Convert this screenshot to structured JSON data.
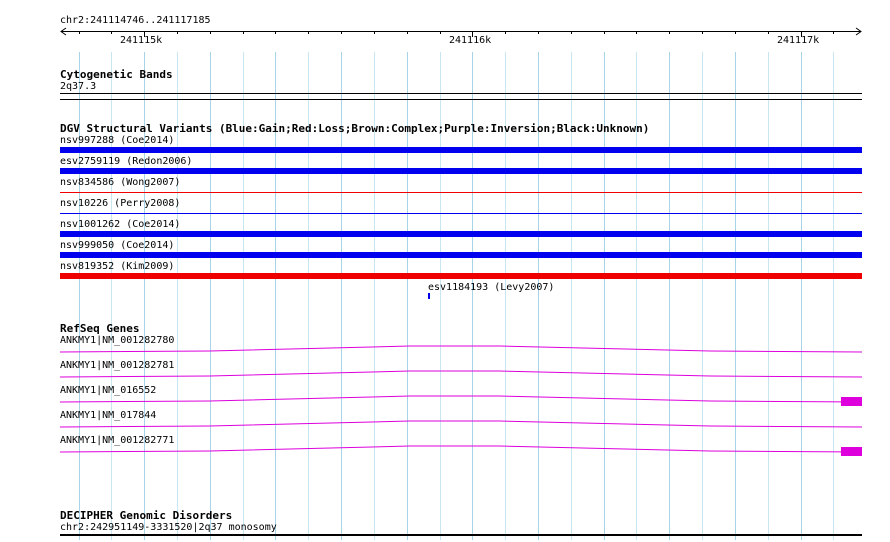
{
  "ruler": {
    "location": "chr2:241114746..241117185",
    "ticks": [
      "241115k",
      "241116k",
      "241117k"
    ]
  },
  "cytoband": {
    "title": "Cytogenetic Bands",
    "band": "2q37.3"
  },
  "dgv": {
    "title": "DGV Structural Variants (Blue:Gain;Red:Loss;Brown:Complex;Purple:Inversion;Black:Unknown)",
    "colors": {
      "gain": "#0000ee",
      "loss": "#ee0000"
    },
    "variants": [
      {
        "label": "nsv997288 (Coe2014)",
        "type": "gain",
        "weight": "thick"
      },
      {
        "label": "esv2759119 (Redon2006)",
        "type": "gain",
        "weight": "thick"
      },
      {
        "label": "nsv834586 (Wong2007)",
        "type": "loss",
        "weight": "thin"
      },
      {
        "label": "nsv10226 (Perry2008)",
        "type": "gain",
        "weight": "thin"
      },
      {
        "label": "nsv1001262 (Coe2014)",
        "type": "gain",
        "weight": "thick"
      },
      {
        "label": "nsv999050 (Coe2014)",
        "type": "gain",
        "weight": "thick"
      },
      {
        "label": "nsv819352 (Kim2009)",
        "type": "loss",
        "weight": "thick"
      },
      {
        "label": "esv1184193 (Levy2007)",
        "type": "gain",
        "weight": "mark"
      }
    ]
  },
  "refseq": {
    "title": "RefSeq Genes",
    "color": "#dd00dd",
    "genes": [
      {
        "label": "ANKMY1|NM_001282780",
        "exon_end": false
      },
      {
        "label": "ANKMY1|NM_001282781",
        "exon_end": false
      },
      {
        "label": "ANKMY1|NM_016552",
        "exon_end": true
      },
      {
        "label": "ANKMY1|NM_017844",
        "exon_end": false
      },
      {
        "label": "ANKMY1|NM_001282771",
        "exon_end": true
      }
    ]
  },
  "decipher": {
    "title": "DECIPHER Genomic Disorders",
    "item": "chr2:242951149-3331520|2q37 monosomy"
  }
}
